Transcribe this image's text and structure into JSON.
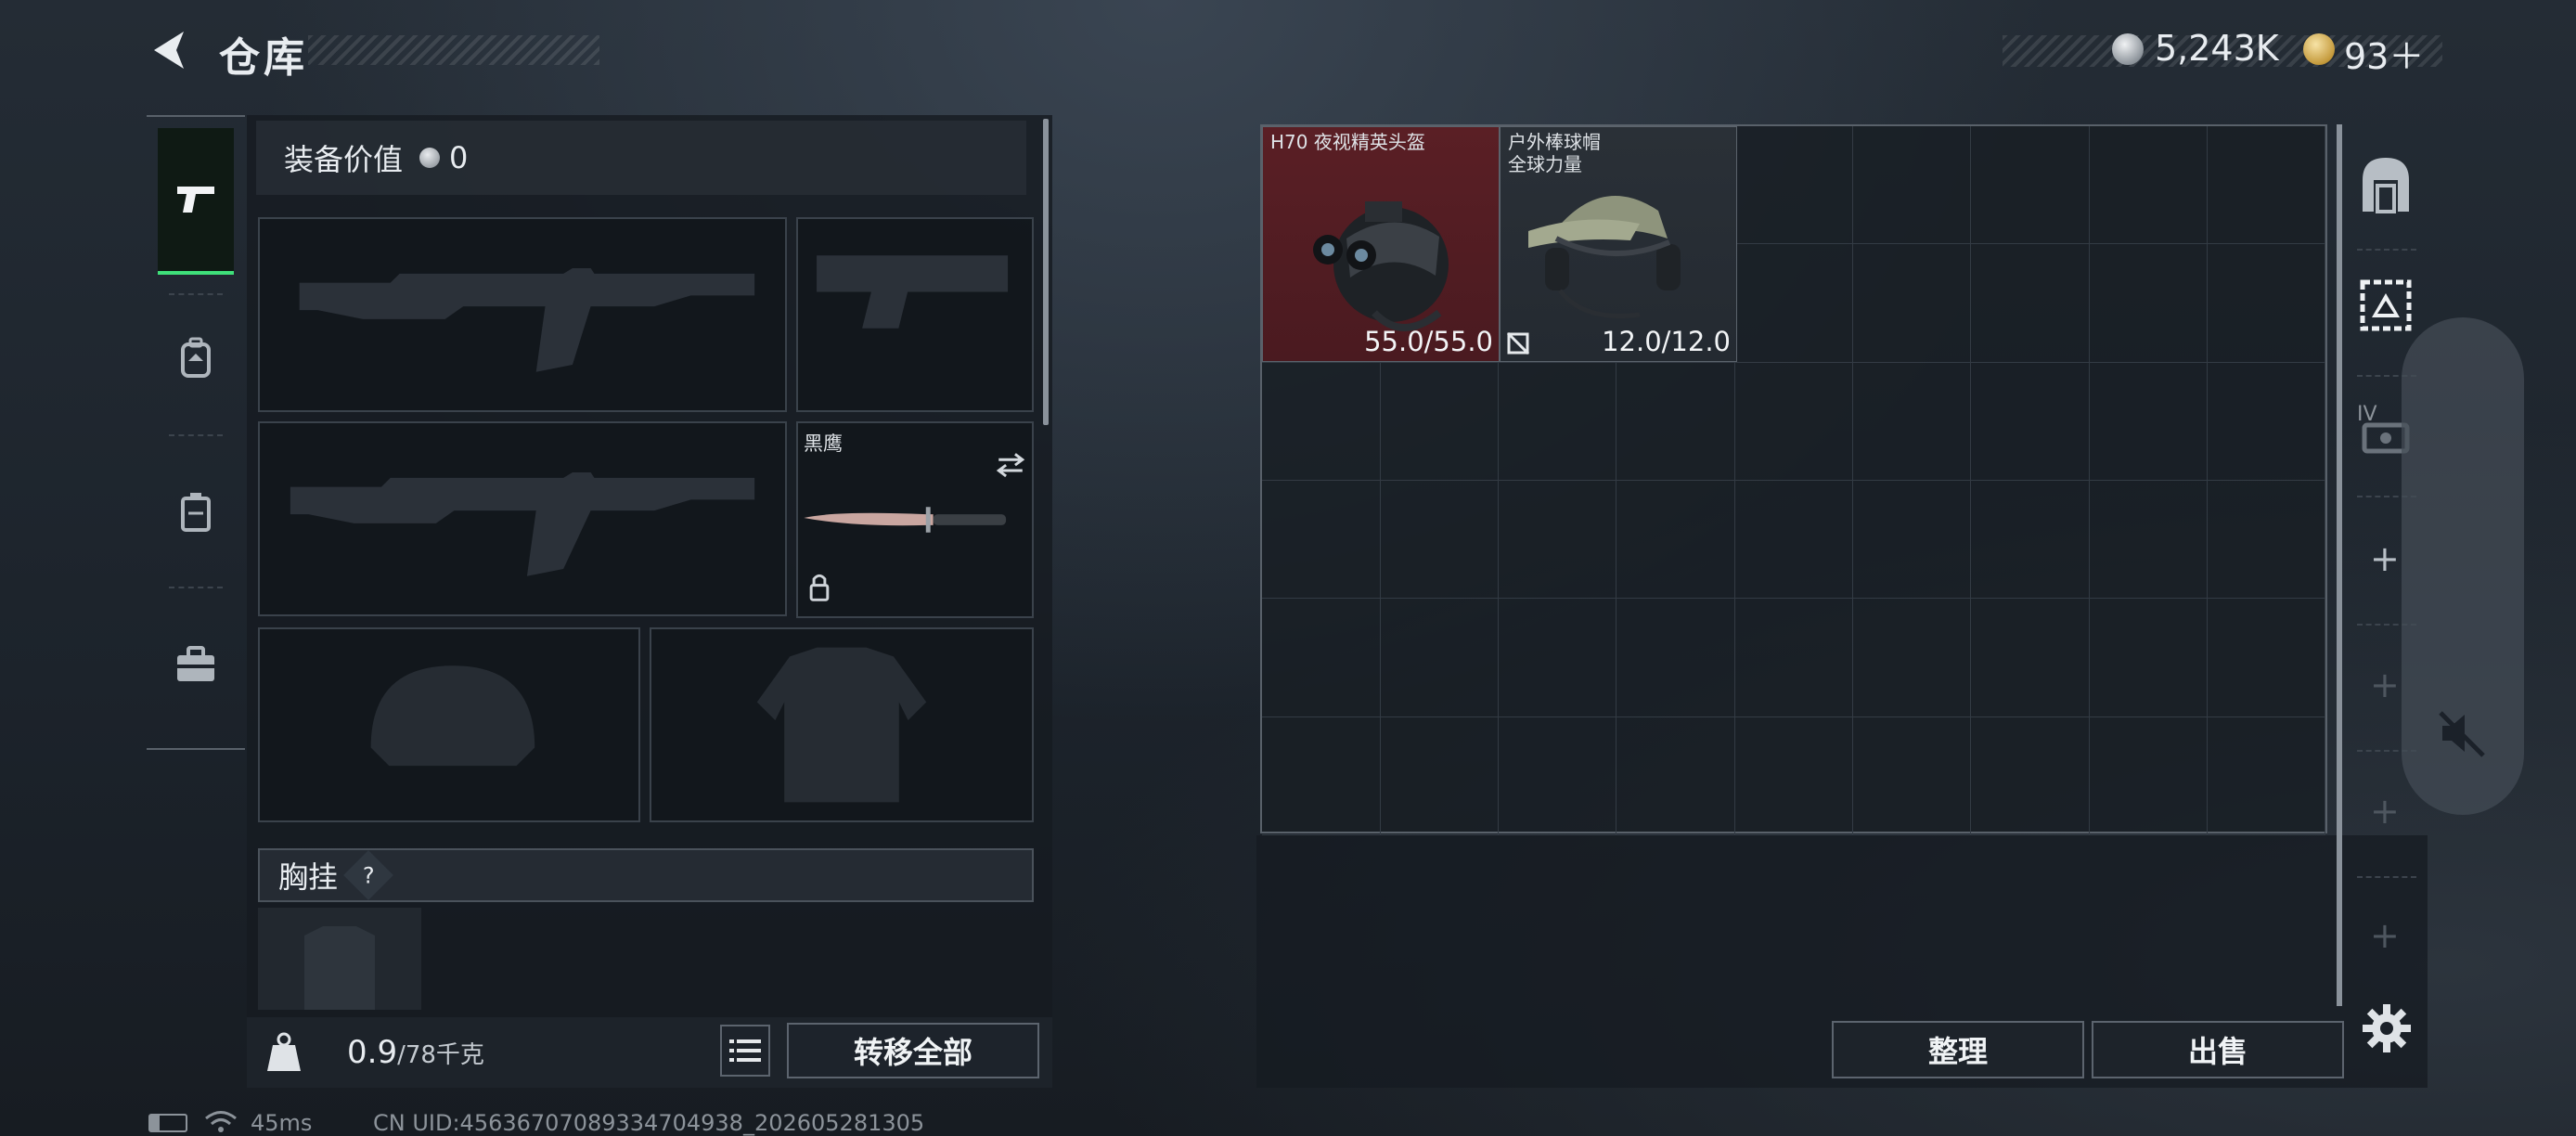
{
  "header": {
    "title": "仓库",
    "currency_silver": "5,243K",
    "currency_gold": "93＋"
  },
  "sidebar": {
    "items": [
      "pistol-tab",
      "backpack-tab",
      "container-tab",
      "toolbox-tab"
    ]
  },
  "equipment": {
    "value_label": "装备价值",
    "value": "0",
    "melee_name": "黑鹰",
    "chest_label": "胸挂",
    "chest_help": "?"
  },
  "weight": {
    "current": "0.9",
    "capacity": "/78千克",
    "icon_text": "KG"
  },
  "buttons": {
    "transfer_all": "转移全部",
    "sort": "整理",
    "sell": "出售"
  },
  "stash_items": [
    {
      "name": "H70 夜视精英头盔",
      "durability": "55.0/55.0"
    },
    {
      "name": "户外棒球帽\n全球力量",
      "durability": "12.0/12.0"
    }
  ],
  "right_sidebar": {
    "roman_label": "IV",
    "plus": "+"
  },
  "status_bar": {
    "ping": "45ms",
    "uid": "CN UID:4563670708933470493​8_202605281305"
  },
  "colors": {
    "active_tab_accent": "#3fe07a",
    "rare_item_bg": "#5a1f25"
  }
}
